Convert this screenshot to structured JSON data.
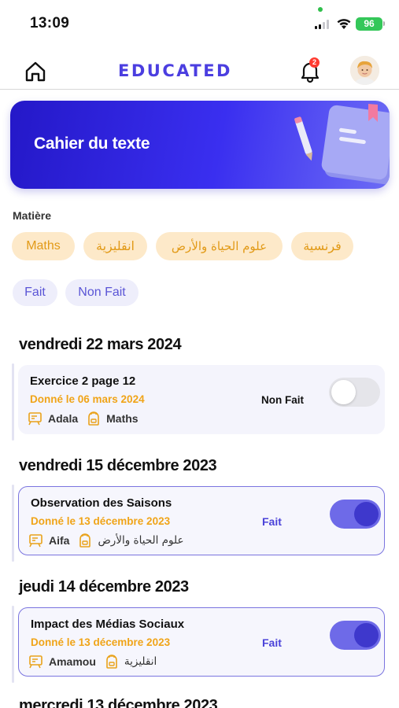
{
  "status_bar": {
    "time": "13:09",
    "battery": "96"
  },
  "header": {
    "brand": "EDUCATED",
    "notifications_count": "2"
  },
  "banner": {
    "title": "Cahier du texte"
  },
  "filters": {
    "subject_label": "Matière",
    "subjects": [
      "Maths",
      "انقليزية",
      "علوم الحياة والأرض",
      "فرنسية"
    ],
    "statuses": [
      "Fait",
      "Non Fait"
    ]
  },
  "days": [
    {
      "date": "vendredi 22 mars 2024",
      "tasks": [
        {
          "title": "Exercice 2 page 12",
          "given": "Donné le 06 mars 2024",
          "teacher": "Adala",
          "subject": "Maths",
          "status": "Non Fait",
          "done": false
        }
      ]
    },
    {
      "date": "vendredi 15 décembre 2023",
      "tasks": [
        {
          "title": "Observation des Saisons",
          "given": "Donné le 13 décembre 2023",
          "teacher": "Aifa",
          "subject": "علوم الحياة والأرض",
          "status": "Fait",
          "done": true
        }
      ]
    },
    {
      "date": "jeudi 14 décembre 2023",
      "tasks": [
        {
          "title": "Impact des Médias Sociaux",
          "given": "Donné le 13 décembre 2023",
          "teacher": "Amamou",
          "subject": "انقليزية",
          "status": "Fait",
          "done": true
        }
      ]
    },
    {
      "date": "mercredi 13 décembre 2023",
      "tasks": []
    }
  ],
  "colors": {
    "accent": "#4b3ee0",
    "chip_bg": "#fde9c9",
    "chip_text": "#e29a17",
    "done_toggle": "#6e6ae8"
  }
}
